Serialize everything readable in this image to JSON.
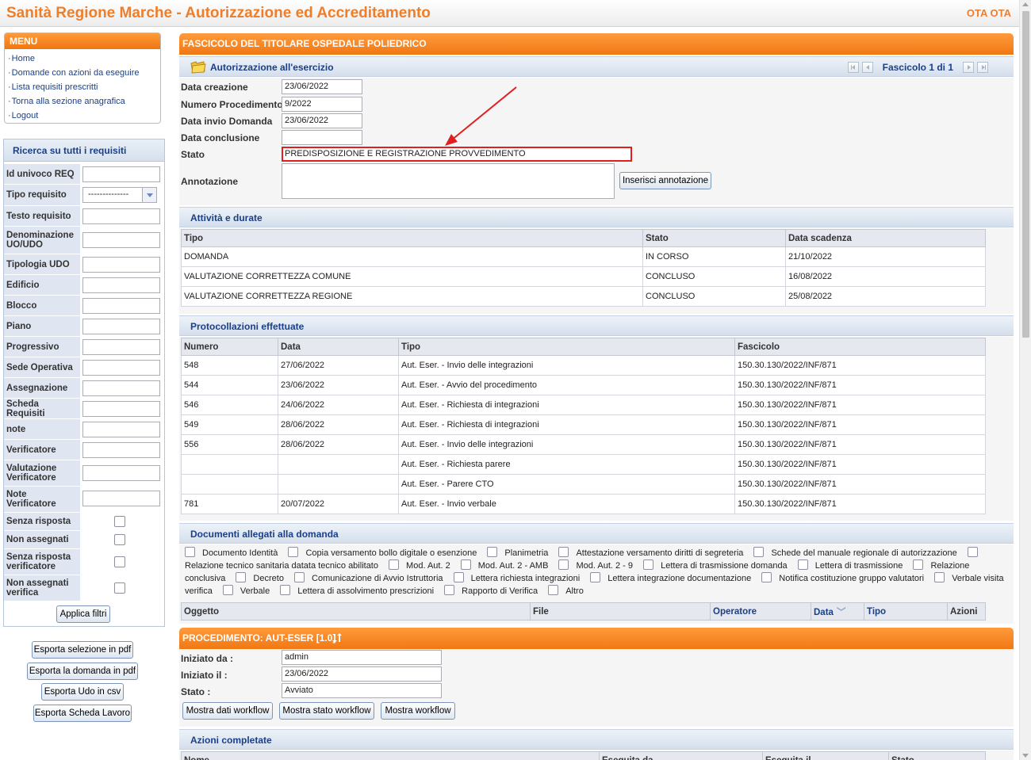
{
  "app": {
    "title": "Sanità Regione Marche - Autorizzazione ed Accreditamento",
    "user": "OTA OTA"
  },
  "menu": {
    "title": "MENU",
    "items": [
      "Home",
      "Domande con azioni da eseguire",
      "Lista requisiti prescritti",
      "Torna alla sezione anagrafica",
      "Logout"
    ]
  },
  "filters": {
    "title": "Ricerca su tutti i requisiti",
    "fields": {
      "id_req": "Id univoco REQ",
      "tipo": "Tipo requisito",
      "tipo_value": "--------------",
      "testo": "Testo requisito",
      "denominazione": "Denominazione UO/UDO",
      "tipologia": "Tipologia UDO",
      "edificio": "Edificio",
      "blocco": "Blocco",
      "piano": "Piano",
      "progressivo": "Progressivo",
      "sede": "Sede Operativa",
      "assegnazione": "Assegnazione",
      "scheda": "Scheda Requisiti",
      "note": "note",
      "verificatore": "Verificatore",
      "valutazione": "Valutazione Verificatore",
      "note_verificatore": "Note Verificatore",
      "senza_risposta": "Senza risposta",
      "non_assegnati": "Non assegnati",
      "senza_risposta_verif": "Senza risposta verificatore",
      "non_assegnati_verif": "Non assegnati verifica"
    },
    "apply": "Applica filtri"
  },
  "export": {
    "sel_pdf": "Esporta selezione in pdf",
    "dom_pdf": "Esporta la domanda in pdf",
    "udo_csv": "Esporta Udo in csv",
    "scheda": "Esporta Scheda Lavoro"
  },
  "fascicolo": {
    "title": "FASCICOLO DEL TITOLARE OSPEDALE POLIEDRICO",
    "sub": "Autorizzazione all'esercizio",
    "pager": "Fascicolo 1 di 1",
    "labels": {
      "creazione": "Data creazione",
      "numero": "Numero Procedimento",
      "invio": "Data invio Domanda",
      "conclusione": "Data conclusione",
      "stato": "Stato",
      "annotazione": "Annotazione"
    },
    "values": {
      "creazione": "23/06/2022",
      "numero": "9/2022",
      "invio": "23/06/2022",
      "conclusione": "",
      "stato": "PREDISPOSIZIONE E REGISTRAZIONE PROVVEDIMENTO"
    },
    "insert_btn": "Inserisci annotazione"
  },
  "attivita": {
    "title": "Attività e durate",
    "headers": [
      "Tipo",
      "Stato",
      "Data scadenza"
    ],
    "rows": [
      [
        "DOMANDA",
        "IN CORSO",
        "21/10/2022"
      ],
      [
        "VALUTAZIONE CORRETTEZZA COMUNE",
        "CONCLUSO",
        "16/08/2022"
      ],
      [
        "VALUTAZIONE CORRETTEZZA REGIONE",
        "CONCLUSO",
        "25/08/2022"
      ]
    ]
  },
  "protocolli": {
    "title": "Protocollazioni effettuate",
    "headers": [
      "Numero",
      "Data",
      "Tipo",
      "Fascicolo"
    ],
    "rows": [
      [
        "548",
        "27/06/2022",
        "Aut. Eser. - Invio delle integrazioni",
        "150.30.130/2022/INF/871"
      ],
      [
        "544",
        "23/06/2022",
        "Aut. Eser. - Avvio del procedimento",
        "150.30.130/2022/INF/871"
      ],
      [
        "546",
        "24/06/2022",
        "Aut. Eser. - Richiesta di integrazioni",
        "150.30.130/2022/INF/871"
      ],
      [
        "549",
        "28/06/2022",
        "Aut. Eser. - Richiesta di integrazioni",
        "150.30.130/2022/INF/871"
      ],
      [
        "556",
        "28/06/2022",
        "Aut. Eser. - Invio delle integrazioni",
        "150.30.130/2022/INF/871"
      ],
      [
        "",
        "",
        "Aut. Eser. - Richiesta parere",
        "150.30.130/2022/INF/871"
      ],
      [
        "",
        "",
        "Aut. Eser. - Parere CTO",
        "150.30.130/2022/INF/871"
      ],
      [
        "781",
        "20/07/2022",
        "Aut. Eser. - Invio verbale",
        "150.30.130/2022/INF/871"
      ]
    ]
  },
  "documenti": {
    "title": "Documenti allegati alla domanda",
    "types": [
      "Documento Identità",
      "Copia versamento bollo digitale o esenzione",
      "Planimetria",
      "Attestazione versamento diritti di segreteria",
      "Schede del manuale regionale di autorizzazione",
      "Relazione tecnico sanitaria datata tecnico abilitato",
      "Mod. Aut. 2",
      "Mod. Aut. 2 - AMB",
      "Mod. Aut. 2 - 9",
      "Lettera di trasmissione domanda",
      "Lettera di trasmissione",
      "Relazione conclusiva",
      "Decreto",
      "Comunicazione di Avvio Istruttoria",
      "Lettera richiesta integrazioni",
      "Lettera integrazione documentazione",
      "Notifica costituzione gruppo valutatori",
      "Verbale visita verifica",
      "Verbale",
      "Lettera di assolvimento prescrizioni",
      "Rapporto di Verifica",
      "Altro"
    ],
    "headers": [
      "Oggetto",
      "File",
      "Operatore",
      "Data",
      "Tipo",
      "Azioni"
    ]
  },
  "procedimento": {
    "title": "PROCEDIMENTO: AUT-ESER [1.0]",
    "labels": {
      "da": "Iniziato da :",
      "il": "Iniziato il :",
      "stato": "Stato :"
    },
    "values": {
      "da": "admin",
      "il": "23/06/2022",
      "stato": "Avviato"
    },
    "buttons": {
      "dati": "Mostra dati workflow",
      "stato": "Mostra stato workflow",
      "workflow": "Mostra workflow"
    }
  },
  "azioni": {
    "title": "Azioni completate",
    "headers": [
      "Nome",
      "Eseguita da",
      "Eseguita il",
      "Stato"
    ]
  },
  "colors": {
    "orange": "#f17813",
    "title_orange": "#ef7e2a",
    "link_blue": "#1a3f87",
    "annotation_red": "#e02020"
  }
}
